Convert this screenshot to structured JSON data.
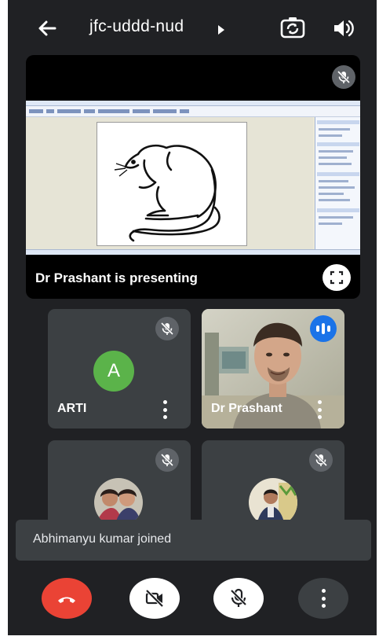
{
  "header": {
    "meeting_code": "jfc-uddd-nud",
    "icons": [
      "back-arrow-icon",
      "chevron-right-icon",
      "switch-camera-icon",
      "speaker-icon"
    ]
  },
  "presentation": {
    "presenter_label": "Dr Prashant is presenting",
    "icons": [
      "mic-off-icon",
      "fullscreen-icon"
    ],
    "shared_content": "document with rat line drawing"
  },
  "participants": [
    {
      "name": "ARTI",
      "avatar_letter": "A",
      "avatar_color": "#5bb34a",
      "muted": true
    },
    {
      "name": "Dr Prashant",
      "speaking": true,
      "video_on": true
    },
    {
      "name": "",
      "muted": true,
      "avatar": "photo"
    },
    {
      "name": "",
      "muted": true,
      "avatar": "photo"
    }
  ],
  "toast": {
    "message": "Abhimanyu kumar joined"
  },
  "controls": {
    "items": [
      "hang-up-icon",
      "video-off-icon",
      "mic-off-icon",
      "more-vert-icon"
    ],
    "hangup_color": "#ea4335"
  },
  "colors": {
    "background": "#202124",
    "tile": "#3c4043",
    "accent": "#1a73e8"
  }
}
